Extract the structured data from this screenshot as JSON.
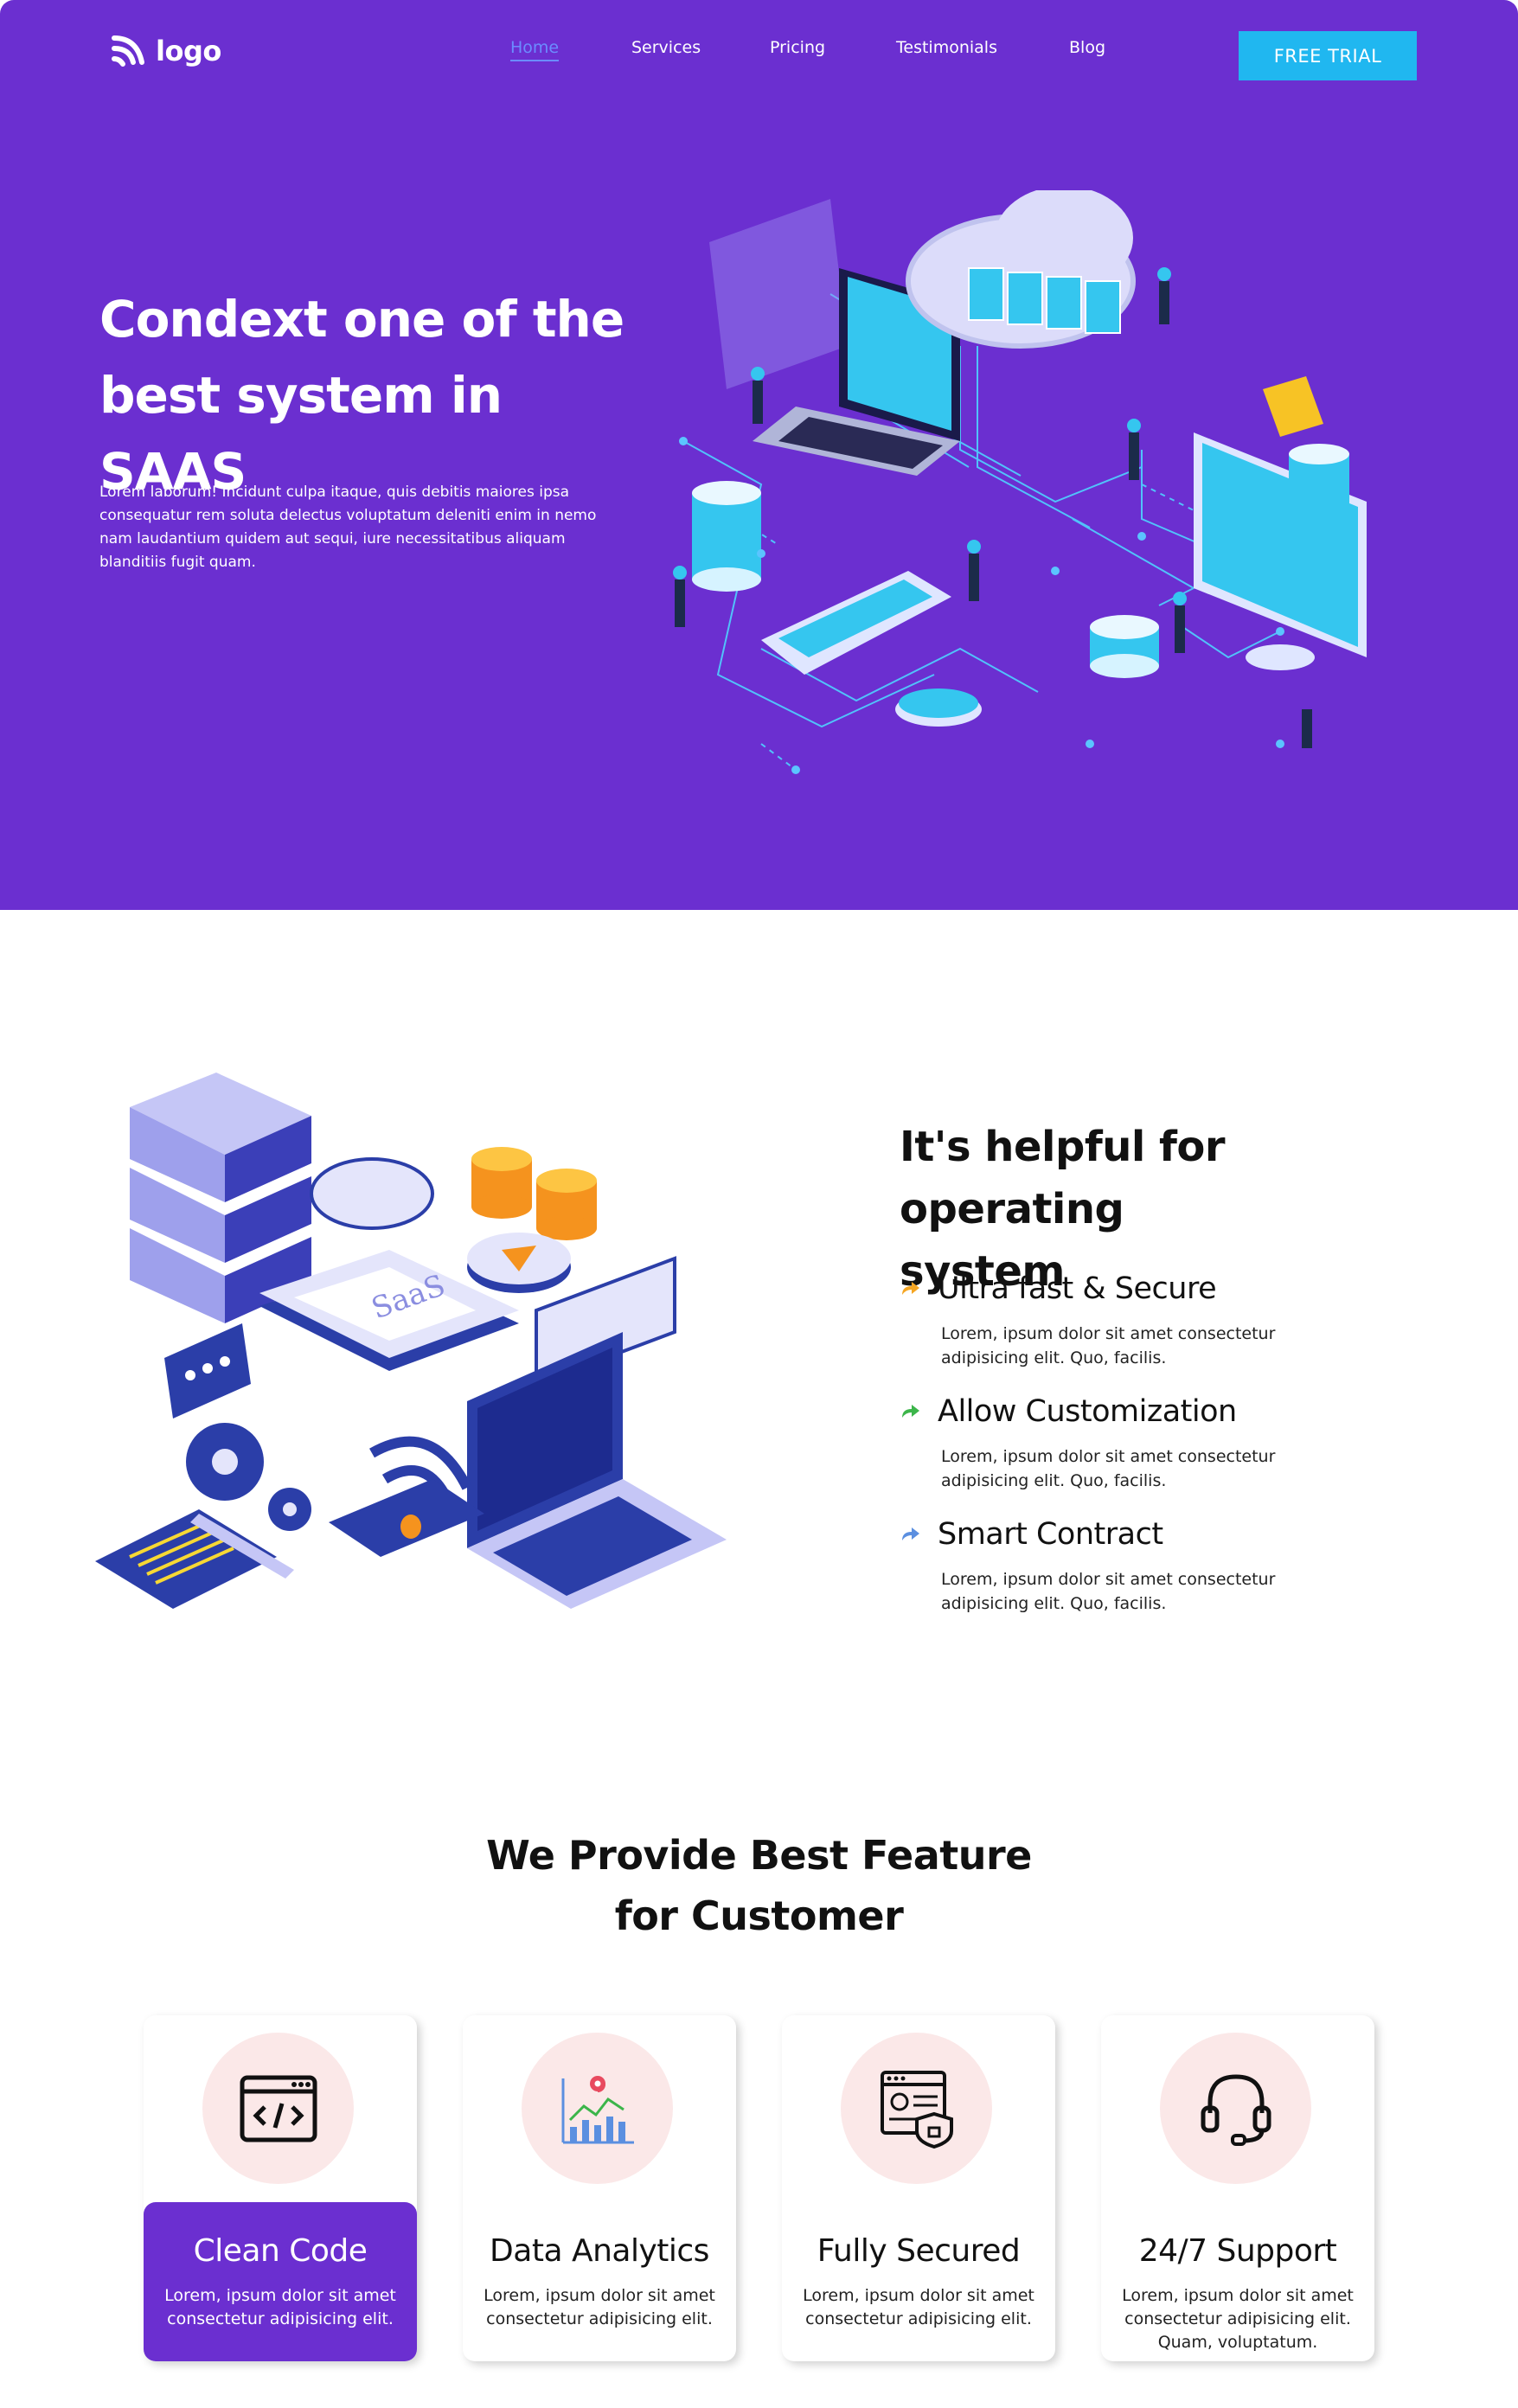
{
  "colors": {
    "hero_bg": "#6b2fd0",
    "accent_button": "#20b7f0",
    "nav_active": "#6b8cff",
    "card_icon_bg": "#fbe8e8",
    "active_card_bg": "#6b2fd0"
  },
  "header": {
    "logo_text": "logo",
    "nav": [
      "Home",
      "Services",
      "Pricing",
      "Testimonials",
      "Blog"
    ],
    "active_nav": "Home",
    "cta_label": "FREE TRIAL"
  },
  "hero": {
    "title_line1": "Condext one of the",
    "title_line2": "best system in SAAS",
    "text": "Lorem laborum! Incidunt culpa itaque, quis debitis maiores ipsa consequatur rem soluta delectus voluptatum deleniti enim in nemo nam laudantium quidem aut sequi, iure necessitatibus aliquam blanditiis fugit quam.",
    "illustration": "isometric-cloud-network-illustration"
  },
  "helpful": {
    "title_line1": "It's helpful for operating",
    "title_line2": "system",
    "illustration": "isometric-saas-illustration",
    "features": [
      {
        "title": "Ultra fast & Secure",
        "desc": "Lorem, ipsum dolor sit amet consectetur adipisicing elit. Quo, facilis.",
        "icon": "arrow-icon",
        "color": "#f5a623"
      },
      {
        "title": "Allow Customization",
        "desc": "Lorem, ipsum dolor sit amet consectetur adipisicing elit. Quo, facilis.",
        "icon": "arrow-icon",
        "color": "#3cb54a"
      },
      {
        "title": "Smart Contract",
        "desc": "Lorem, ipsum dolor sit amet consectetur adipisicing elit. Quo, facilis.",
        "icon": "arrow-icon",
        "color": "#5b8fe0"
      }
    ]
  },
  "features_section": {
    "title_line1": "We Provide Best Feature",
    "title_line2": "for Customer",
    "cards": [
      {
        "title": "Clean Code",
        "desc": "Lorem, ipsum dolor sit amet consectetur adipisicing elit.",
        "icon": "code-icon",
        "active": true
      },
      {
        "title": "Data Analytics",
        "desc": "Lorem, ipsum dolor sit amet consectetur adipisicing elit.",
        "icon": "analytics-icon",
        "active": false
      },
      {
        "title": "Fully Secured",
        "desc": "Lorem, ipsum dolor sit amet consectetur adipisicing elit.",
        "icon": "secure-profile-icon",
        "active": false
      },
      {
        "title": "24/7 Support",
        "desc": "Lorem, ipsum dolor sit amet consectetur adipisicing elit. Quam, voluptatum.",
        "icon": "headset-icon",
        "active": false
      }
    ]
  }
}
